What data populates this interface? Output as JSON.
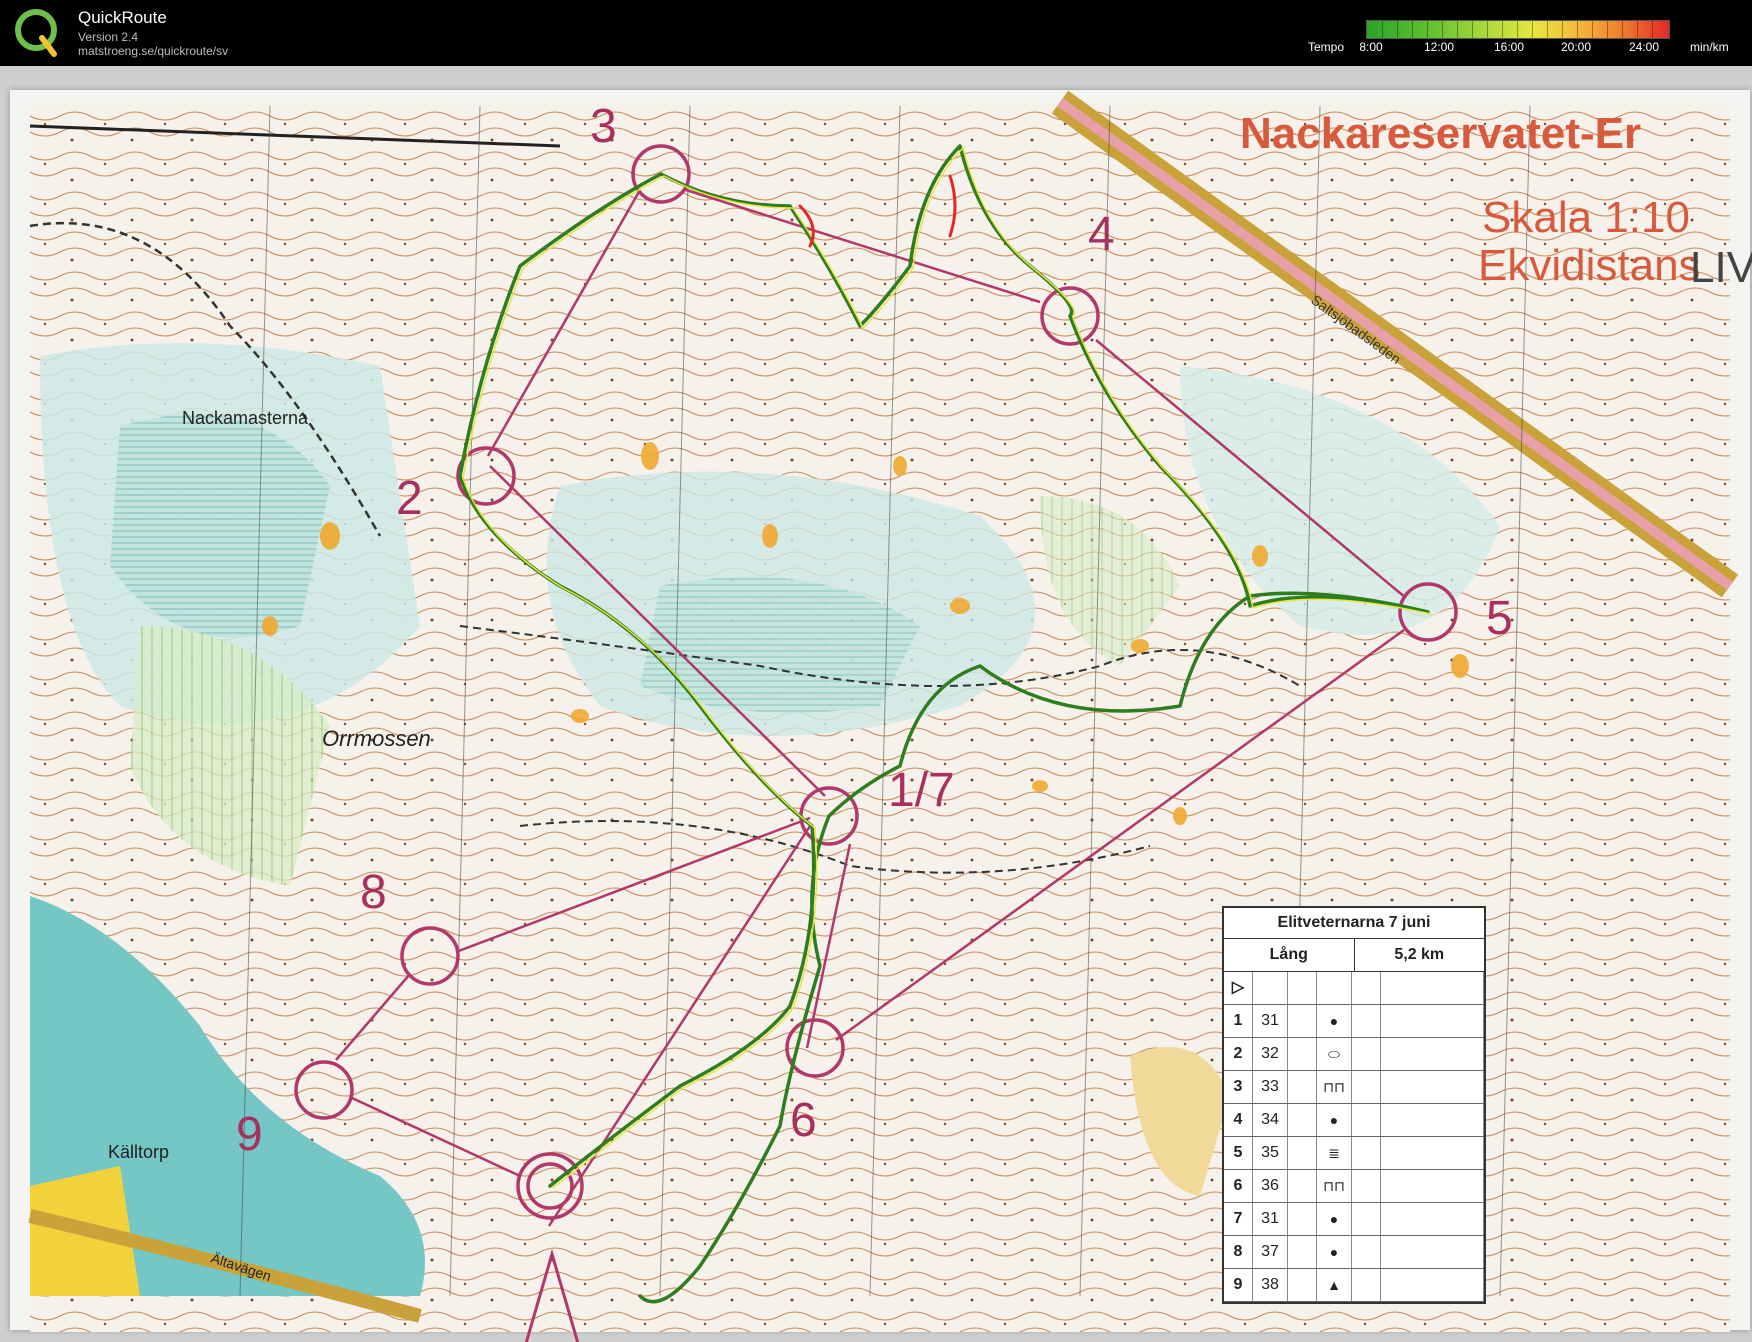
{
  "app": {
    "title": "QuickRoute",
    "version": "Version 2.4",
    "url": "matstroeng.se/quickroute/sv"
  },
  "tempo": {
    "label": "Tempo",
    "ticks": [
      "8:00",
      "12:00",
      "16:00",
      "20:00",
      "24:00"
    ],
    "unit": "min/km",
    "colors": [
      "#2aa42a",
      "#a6d83a",
      "#e6e640",
      "#f5b83a",
      "#f07a2e",
      "#e32828"
    ]
  },
  "map": {
    "title": "Nackareservatet-Er",
    "scale": "Skala 1:10",
    "equidistance": "Ekvidistans",
    "logo_fragment": "LIV",
    "road_label": "Saltsjöbadsleden",
    "place_names": [
      "Nackamasterna",
      "Orrmossen",
      "Källtorp",
      "Ältavägen"
    ],
    "control_numbers": [
      "1/7",
      "2",
      "3",
      "4",
      "5",
      "6",
      "8",
      "9"
    ],
    "course_color": "#b0386a",
    "route_color": "#2e7d1e"
  },
  "control_card": {
    "event": "Elitveternarna 7 juni",
    "course": "Lång",
    "distance": "5,2 km",
    "rows": [
      {
        "n": "1",
        "code": "31",
        "sym": "●"
      },
      {
        "n": "2",
        "code": "32",
        "sym": "⬭"
      },
      {
        "n": "3",
        "code": "33",
        "sym": "⊓⊓"
      },
      {
        "n": "4",
        "code": "34",
        "sym": "●"
      },
      {
        "n": "5",
        "code": "35",
        "sym": "≣"
      },
      {
        "n": "6",
        "code": "36",
        "sym": "⊓⊓"
      },
      {
        "n": "7",
        "code": "31",
        "sym": "●"
      },
      {
        "n": "8",
        "code": "37",
        "sym": "●"
      },
      {
        "n": "9",
        "code": "38",
        "sym": "▲"
      }
    ]
  }
}
